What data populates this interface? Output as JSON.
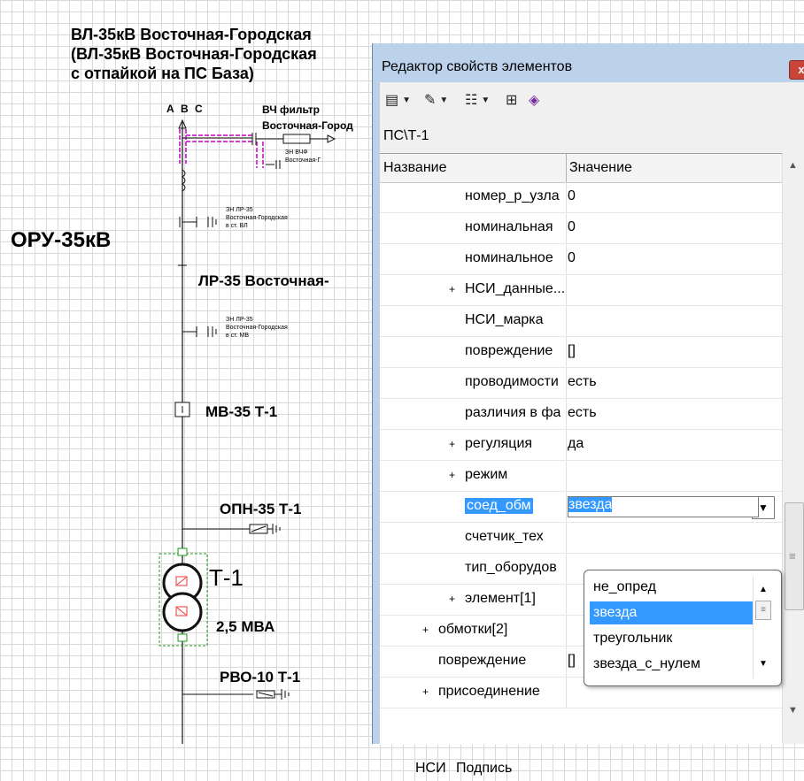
{
  "diagram": {
    "title_lines": [
      "ВЛ-35кВ Восточная-Городская",
      "(ВЛ-35кВ Восточная-Городская",
      "с отпайкой на ПС База)"
    ],
    "phases": "А В С",
    "vch_filter": "ВЧ фильтр",
    "vch_filter_sub": "Восточная-Город",
    "zn_vchf_1": "ЗН ВЧФ",
    "zn_vchf_2": "Восточная-Г",
    "oru": "ОРУ-35кВ",
    "zn_lr_vl": [
      "ЗН ЛР-35",
      "Восточная-Городская",
      "в ст. ВЛ"
    ],
    "lr35": "ЛР-35 Восточная-",
    "zn_lr_mv": [
      "ЗН ЛР-35",
      "Восточная-Городская",
      "в ст. МВ"
    ],
    "mv35": "МВ-35 Т-1",
    "opn35": "ОПН-35 Т-1",
    "t1": "Т-1",
    "t1_power": "2,5 МВА",
    "rvo10": "РВО-10 Т-1"
  },
  "dialog": {
    "title": "Редактор свойств элементов",
    "close": "x",
    "path": "ПС\\Т-1",
    "columns": [
      "Название",
      "Значение"
    ],
    "rows": [
      {
        "name": "номер_р_узла",
        "value": "0",
        "exp": "",
        "indent": 2
      },
      {
        "name": "номинальная",
        "value": "0",
        "exp": "",
        "indent": 2
      },
      {
        "name": "номинальное",
        "value": "0",
        "exp": "",
        "indent": 2
      },
      {
        "name": "НСИ_данные...",
        "value": "",
        "exp": "+",
        "indent": 2
      },
      {
        "name": "НСИ_марка",
        "value": "",
        "exp": "",
        "indent": 2
      },
      {
        "name": "повреждение",
        "value": "[]",
        "exp": "",
        "indent": 2
      },
      {
        "name": "проводимости",
        "value": "есть",
        "exp": "",
        "indent": 2
      },
      {
        "name": "различия в фа",
        "value": "есть",
        "exp": "",
        "indent": 2
      },
      {
        "name": "регуляция",
        "value": "да",
        "exp": "+",
        "indent": 2
      },
      {
        "name": "режим",
        "value": "",
        "exp": "+",
        "indent": 2
      },
      {
        "name": "соед_обм",
        "value": "звезда",
        "exp": "",
        "indent": 2,
        "selected": true
      },
      {
        "name": "счетчик_тех",
        "value": "",
        "exp": "",
        "indent": 2
      },
      {
        "name": "тип_оборудов",
        "value": "",
        "exp": "",
        "indent": 2
      },
      {
        "name": "элемент[1]",
        "value": "",
        "exp": "+",
        "indent": 2
      },
      {
        "name": "обмотки[2]",
        "value": "",
        "exp": "+",
        "indent": 1
      },
      {
        "name": "повреждение",
        "value": "[]",
        "exp": "",
        "indent": 1
      },
      {
        "name": "присоединение",
        "value": "",
        "exp": "+",
        "indent": 1
      }
    ],
    "dropdown_options": [
      "не_опред",
      "звезда",
      "треугольник",
      "звезда_с_нулем"
    ],
    "dropdown_selected": 1,
    "status": [
      "НСИ",
      "Подпись"
    ]
  },
  "colors": {
    "selection": "#3399ff",
    "window_frame": "#bcd1ea",
    "close_button": "#c8453a",
    "highlight_line": "#d23fd2",
    "selection_box": "#1a9a1a",
    "transformer_fill": "#e33"
  }
}
